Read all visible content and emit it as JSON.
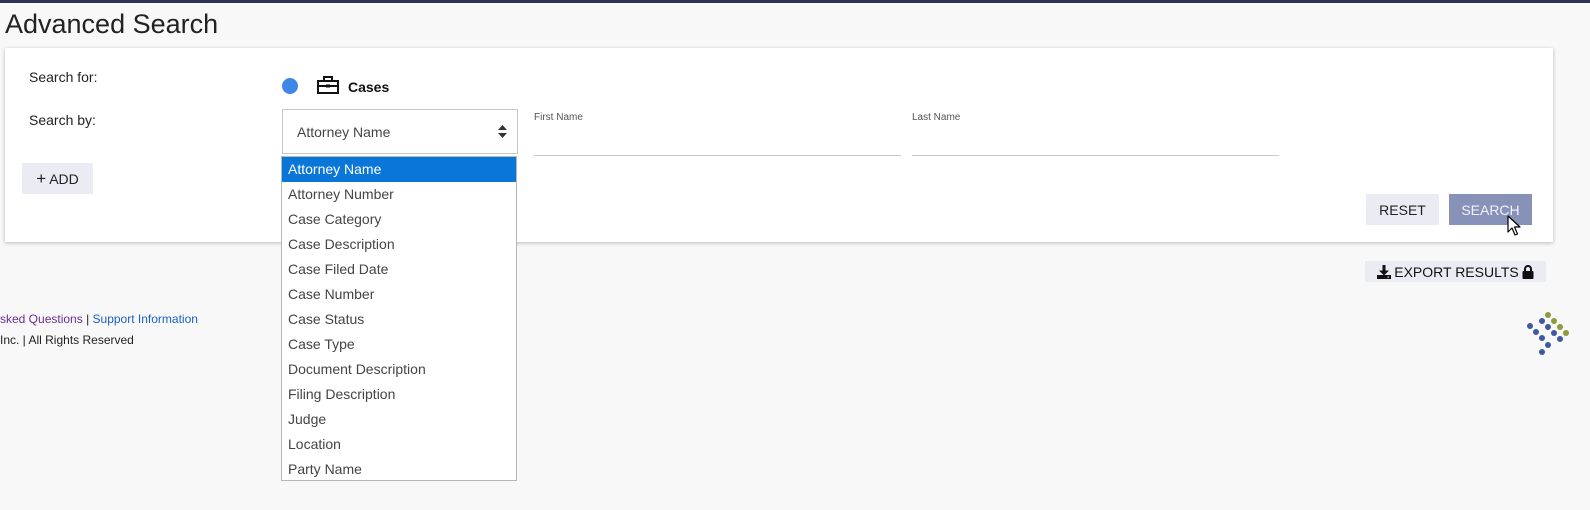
{
  "page": {
    "title": "Advanced Search"
  },
  "form": {
    "search_for_label": "Search for:",
    "search_by_label": "Search by:",
    "search_for_option": {
      "label": "Cases",
      "icon": "briefcase-icon",
      "radio_color": "#3f86e9"
    },
    "search_by_select": {
      "value": "Attorney Name"
    },
    "first_name": {
      "label": "First Name",
      "value": ""
    },
    "last_name": {
      "label": "Last Name",
      "value": ""
    },
    "add_label": "ADD",
    "reset_label": "RESET",
    "search_label": "SEARCH"
  },
  "dropdown": {
    "options": [
      "Attorney Name",
      "Attorney Number",
      "Case Category",
      "Case Description",
      "Case Filed Date",
      "Case Number",
      "Case Status",
      "Case Type",
      "Document Description",
      "Filing Description",
      "Judge",
      "Location",
      "Party Name"
    ],
    "selected_index": 0,
    "highlight_color": "#0a76d8"
  },
  "results": {
    "export_label": "EXPORT RESULTS"
  },
  "footer": {
    "faq_link": "sked Questions",
    "separator": "|",
    "support_link": "Support Information",
    "copyright": "Inc. | All Rights Reserved"
  },
  "colors": {
    "topbar": "#2b3655",
    "search_button": "#8892b8",
    "secondary_button": "#ebebf3"
  }
}
